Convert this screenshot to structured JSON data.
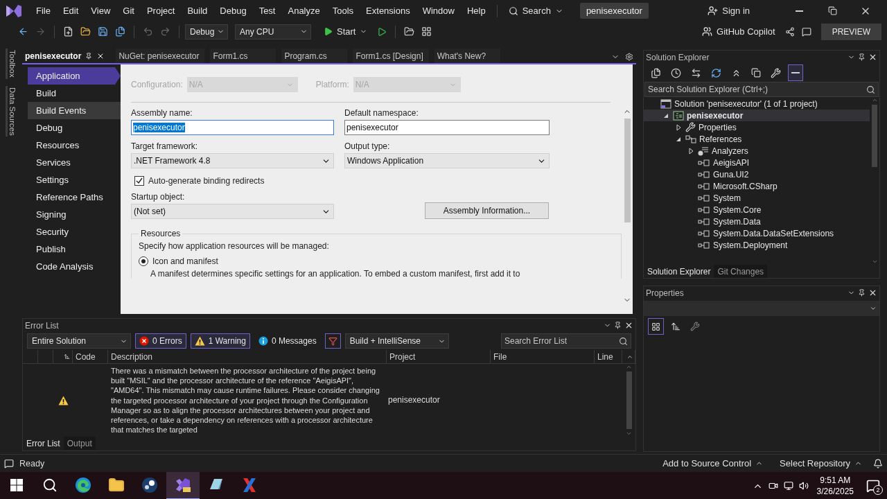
{
  "menu_bar": {
    "items": [
      "File",
      "Edit",
      "View",
      "Git",
      "Project",
      "Build",
      "Debug",
      "Test",
      "Analyze",
      "Tools",
      "Extensions",
      "Window",
      "Help"
    ],
    "search": "Search",
    "solution_badge": "penisexecutor",
    "sign_in": "Sign in"
  },
  "toolbar": {
    "configuration": "Debug",
    "platform": "Any CPU",
    "start": "Start",
    "copilot": "GitHub Copilot",
    "preview": "PREVIEW"
  },
  "side_strip": [
    "Toolbox",
    "Data Sources"
  ],
  "doc_tabs": [
    {
      "label": "penisexecutor",
      "selected": true
    },
    {
      "label": "NuGet: penisexecutor",
      "selected": false
    },
    {
      "label": "Form1.cs",
      "selected": false
    },
    {
      "label": "Program.cs",
      "selected": false
    },
    {
      "label": "Form1.cs [Design]",
      "selected": false
    },
    {
      "label": "What's New?",
      "selected": false
    }
  ],
  "project_properties": {
    "nav": [
      {
        "label": "Application",
        "selected": true,
        "hovered": false
      },
      {
        "label": "Build",
        "selected": false,
        "hovered": false
      },
      {
        "label": "Build Events",
        "selected": false,
        "hovered": true
      },
      {
        "label": "Debug",
        "selected": false,
        "hovered": false
      },
      {
        "label": "Resources",
        "selected": false,
        "hovered": false
      },
      {
        "label": "Services",
        "selected": false,
        "hovered": false
      },
      {
        "label": "Settings",
        "selected": false,
        "hovered": false
      },
      {
        "label": "Reference Paths",
        "selected": false,
        "hovered": false
      },
      {
        "label": "Signing",
        "selected": false,
        "hovered": false
      },
      {
        "label": "Security",
        "selected": false,
        "hovered": false
      },
      {
        "label": "Publish",
        "selected": false,
        "hovered": false
      },
      {
        "label": "Code Analysis",
        "selected": false,
        "hovered": false
      }
    ],
    "configuration_label": "Configuration:",
    "configuration": "N/A",
    "platform_label": "Platform:",
    "platform": "N/A",
    "assembly_name_label": "Assembly name:",
    "assembly_name": "penisexecutor",
    "assembly_name_text_selected": true,
    "default_namespace_label": "Default namespace:",
    "default_namespace": "penisexecutor",
    "target_framework_label": "Target framework:",
    "target_framework": ".NET Framework 4.8",
    "output_type_label": "Output type:",
    "output_type": "Windows Application",
    "binding_redirects": {
      "label": "Auto-generate binding redirects",
      "checked": true
    },
    "startup_object_label": "Startup object:",
    "startup_object": "(Not set)",
    "assembly_info_button": "Assembly Information...",
    "resources": {
      "title": "Resources",
      "intro": "Specify how application resources will be managed:",
      "options": [
        {
          "label": "Icon and manifest",
          "selected": true
        }
      ],
      "description": "A manifest determines specific settings for an application. To embed a custom manifest, first add it to"
    }
  },
  "error_list": {
    "title": "Error List",
    "scope": "Entire Solution",
    "filters": [
      {
        "kind": "error",
        "label": "0 Errors",
        "selected": true
      },
      {
        "kind": "warning",
        "label": "1 Warning",
        "selected": true
      },
      {
        "kind": "message",
        "label": "0 Messages",
        "selected": false
      }
    ],
    "source": "Build + IntelliSense",
    "search_placeholder": "Search Error List",
    "columns": [
      "Code",
      "Description",
      "Project",
      "File",
      "Line"
    ],
    "rows": [
      {
        "kind": "warning",
        "description": "There was a mismatch between the processor architecture of the project being built \"MSIL\" and the processor architecture of the reference \"AeigisAPI\", \"AMD64\". This mismatch may cause runtime failures. Please consider changing the targeted processor architecture of your project through the Configuration Manager so as to align the processor architectures between your project and references, or take a dependency on references with a processor architecture that matches the targeted",
        "project": "penisexecutor"
      }
    ],
    "tabs": [
      {
        "label": "Error List",
        "selected": true
      },
      {
        "label": "Output",
        "selected": false
      }
    ]
  },
  "solution_explorer": {
    "title": "Solution Explorer",
    "search_placeholder": "Search Solution Explorer (Ctrl+;)",
    "tree": [
      {
        "kind": "solution",
        "label": "Solution 'penisexecutor' (1 of 1 project)",
        "selected": false,
        "children": [
          {
            "kind": "project",
            "label": "penisexecutor",
            "selected": true,
            "expanded": true,
            "children": [
              {
                "kind": "properties",
                "label": "Properties",
                "selected": false,
                "expanded": false
              },
              {
                "kind": "references",
                "label": "References",
                "selected": false,
                "expanded": true,
                "children": [
                  {
                    "kind": "analyzers",
                    "label": "Analyzers",
                    "selected": false,
                    "expanded": false
                  },
                  {
                    "kind": "reference",
                    "label": "AeigisAPI",
                    "selected": false
                  },
                  {
                    "kind": "reference",
                    "label": "Guna.UI2",
                    "selected": false
                  },
                  {
                    "kind": "reference",
                    "label": "Microsoft.CSharp",
                    "selected": false
                  },
                  {
                    "kind": "reference",
                    "label": "System",
                    "selected": false
                  },
                  {
                    "kind": "reference",
                    "label": "System.Core",
                    "selected": false
                  },
                  {
                    "kind": "reference",
                    "label": "System.Data",
                    "selected": false
                  },
                  {
                    "kind": "reference",
                    "label": "System.Data.DataSetExtensions",
                    "selected": false
                  },
                  {
                    "kind": "reference",
                    "label": "System.Deployment",
                    "selected": false
                  }
                ]
              }
            ]
          }
        ]
      }
    ],
    "tabs": [
      {
        "label": "Solution Explorer",
        "selected": true
      },
      {
        "label": "Git Changes",
        "selected": false
      }
    ]
  },
  "properties_panel": {
    "title": "Properties"
  },
  "status_bar": {
    "ready": "Ready",
    "source_control": "Add to Source Control",
    "repository": "Select Repository"
  },
  "taskbar": {
    "apps": [
      {
        "kind": "browser",
        "selected": false
      },
      {
        "kind": "folder",
        "selected": false
      },
      {
        "kind": "disc",
        "selected": false
      },
      {
        "kind": "ribbon",
        "selected": true
      },
      {
        "kind": "crystal",
        "selected": false
      },
      {
        "kind": "xlogo",
        "selected": false
      }
    ],
    "time": "9:51 AM",
    "date": "3/26/2025",
    "notifications": "2"
  }
}
